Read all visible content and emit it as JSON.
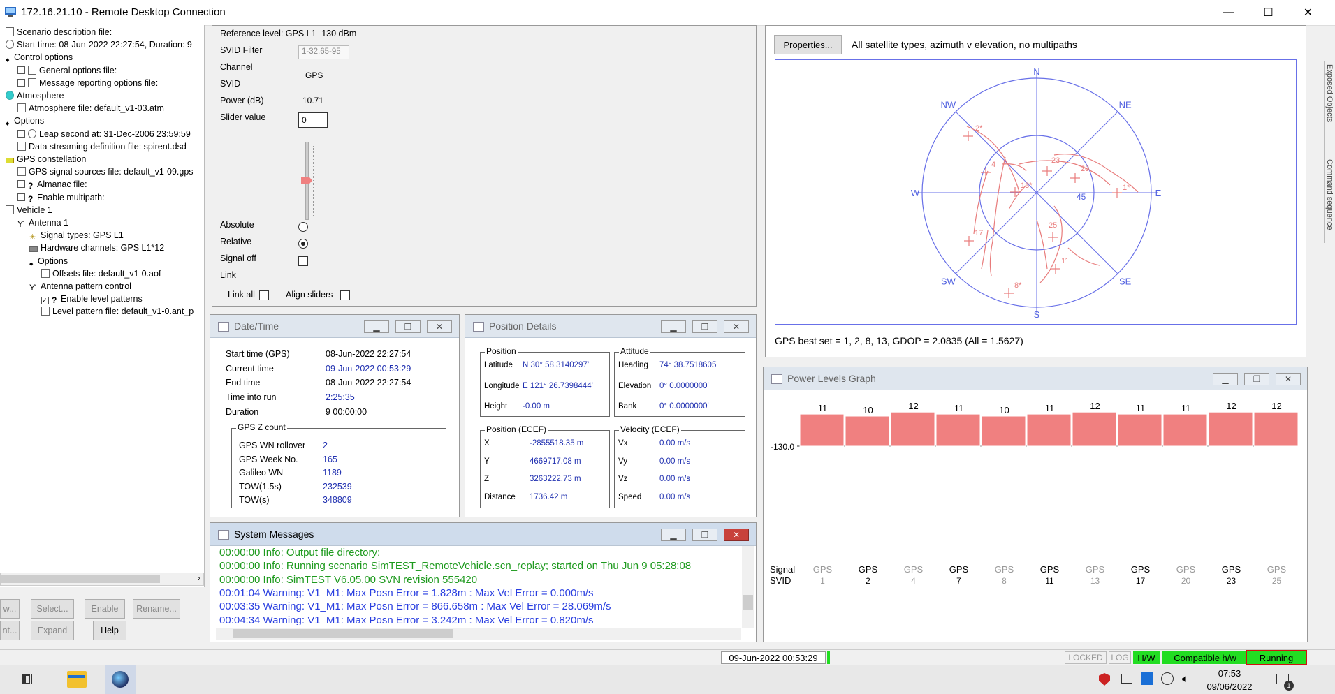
{
  "window": {
    "title": "172.16.21.10 - Remote Desktop Connection"
  },
  "tree": {
    "items": [
      "Scenario description file:",
      "Start time: 08-Jun-2022 22:27:54, Duration: 9",
      "Control  options",
      "General options file:",
      "Message reporting options file:",
      "Atmosphere",
      "Atmosphere file: default_v1-03.atm",
      "Options",
      "Leap second at: 31-Dec-2006 23:59:59",
      "Data streaming definition file: spirent.dsd",
      "GPS constellation",
      "GPS signal sources file: default_v1-09.gps",
      "Almanac file:",
      "Enable multipath:",
      "Vehicle 1",
      "Antenna  1",
      "Signal types: GPS L1",
      "Hardware channels: GPS L1*12",
      "Options",
      "Offsets file: default_v1-0.aof",
      "Antenna pattern control",
      "Enable level patterns",
      "Level pattern file: default_v1-0.ant_p"
    ],
    "buttons": [
      "w...",
      "Select...",
      "Enable",
      "Rename...",
      "nt...",
      "Expand",
      "Help"
    ]
  },
  "power_panel": {
    "reference_level": "Reference level: GPS L1 -130 dBm",
    "svid_filter_label": "SVID Filter",
    "svid_filter_value": "1-32,65-95",
    "channel_label": "Channel",
    "svid_label": "SVID",
    "svid_value": "GPS",
    "power_label": "Power (dB)",
    "power_value": "10.71",
    "slider_label": "Slider value",
    "slider_value": "0",
    "absolute_label": "Absolute",
    "relative_label": "Relative",
    "signal_off_label": "Signal off",
    "link_label": "Link",
    "link_all_label": "Link all",
    "align_sliders_label": "Align sliders"
  },
  "datetime": {
    "title": "Date/Time",
    "rows": [
      {
        "label": "Start time (GPS)",
        "value": "08-Jun-2022 22:27:54"
      },
      {
        "label": "Current time",
        "value": "09-Jun-2022 00:53:29"
      },
      {
        "label": "End time",
        "value": "08-Jun-2022 22:27:54"
      },
      {
        "label": "Time into run",
        "value": "2:25:35"
      },
      {
        "label": "Duration",
        "value": "9 00:00:00"
      }
    ],
    "zcount_title": "GPS Z count",
    "zcount": [
      {
        "label": "GPS WN rollover",
        "value": "2"
      },
      {
        "label": "GPS Week No.",
        "value": "165"
      },
      {
        "label": "Galileo WN",
        "value": "1189"
      },
      {
        "label": "TOW(1.5s)",
        "value": "232539"
      },
      {
        "label": "TOW(s)",
        "value": "348809"
      }
    ]
  },
  "position": {
    "title": "Position Details",
    "pos_title": "Position",
    "pos": [
      {
        "label": "Latitude",
        "value": "N 30° 58.3140297'"
      },
      {
        "label": "Longitude",
        "value": "E 121° 26.7398444'"
      },
      {
        "label": "Height",
        "value": "-0.00 m"
      }
    ],
    "att_title": "Attitude",
    "att": [
      {
        "label": "Heading",
        "value": "74° 38.7518605'"
      },
      {
        "label": "Elevation",
        "value": "0° 0.0000000'"
      },
      {
        "label": "Bank",
        "value": "0° 0.0000000'"
      }
    ],
    "ecef_title": "Position (ECEF)",
    "ecef": [
      {
        "label": "X",
        "value": "-2855518.35 m"
      },
      {
        "label": "Y",
        "value": "4669717.08 m"
      },
      {
        "label": "Z",
        "value": "3263222.73 m"
      },
      {
        "label": "Distance",
        "value": "1736.42 m"
      }
    ],
    "vel_title": "Velocity (ECEF)",
    "vel": [
      {
        "label": "Vx",
        "value": "0.00 m/s"
      },
      {
        "label": "Vy",
        "value": "0.00 m/s"
      },
      {
        "label": "Vz",
        "value": "0.00 m/s"
      },
      {
        "label": "Speed",
        "value": "0.00 m/s"
      }
    ]
  },
  "sysmsg": {
    "title": "System Messages",
    "lines": [
      {
        "text": "00:00:00 Info:     Output file directory:",
        "color": "#1e9a1e"
      },
      {
        "text": "00:00:00 Info: Running scenario SimTEST_RemoteVehicle.scn_replay; started on Thu Jun  9 05:28:08",
        "color": "#1e9a1e"
      },
      {
        "text": "00:00:00 Info: SimTEST V6.05.00 SVN revision 555420",
        "color": "#1e9a1e"
      },
      {
        "text": "00:01:04 Warning: V1_M1: Max Posn Error = 1.828m : Max Vel Error = 0.000m/s",
        "color": "#2a3fe0"
      },
      {
        "text": "00:03:35 Warning: V1_M1: Max Posn Error = 866.658m : Max Vel Error = 28.069m/s",
        "color": "#2a3fe0"
      },
      {
        "text": "00:04:34 Warning: V1_M1: Max Posn Error = 3.242m : Max Vel Error = 0.820m/s",
        "color": "#2a3fe0"
      }
    ]
  },
  "skyplot": {
    "properties_button": "Properties...",
    "description": "All satellite types, azimuth v elevation, no multipaths",
    "directions": [
      "N",
      "NE",
      "E",
      "SE",
      "S",
      "SW",
      "W",
      "NW"
    ],
    "ring_label": "45",
    "gdop_text": "GPS best set = 1, 2, 8, 13, GDOP = 2.0835 (All = 1.5627)",
    "sats": [
      "2*",
      "4",
      "13*",
      "23",
      "20",
      "1*",
      "17",
      "25",
      "11",
      "8*"
    ]
  },
  "power_graph": {
    "title": "Power Levels Graph",
    "y_label": "-130.0",
    "row_label_signal": "Signal",
    "row_label_svid": "SVID",
    "color": "#f08080",
    "bars": [
      {
        "signal": "GPS",
        "svid": "1",
        "level": 11,
        "active": false
      },
      {
        "signal": "GPS",
        "svid": "2",
        "level": 10,
        "active": true
      },
      {
        "signal": "GPS",
        "svid": "4",
        "level": 12,
        "active": false
      },
      {
        "signal": "GPS",
        "svid": "7",
        "level": 11,
        "active": true
      },
      {
        "signal": "GPS",
        "svid": "8",
        "level": 10,
        "active": false
      },
      {
        "signal": "GPS",
        "svid": "11",
        "level": 11,
        "active": true
      },
      {
        "signal": "GPS",
        "svid": "13",
        "level": 12,
        "active": false
      },
      {
        "signal": "GPS",
        "svid": "17",
        "level": 11,
        "active": true
      },
      {
        "signal": "GPS",
        "svid": "20",
        "level": 11,
        "active": false
      },
      {
        "signal": "GPS",
        "svid": "23",
        "level": 12,
        "active": true
      },
      {
        "signal": "GPS",
        "svid": "25",
        "level": 12,
        "active": false
      }
    ]
  },
  "status": {
    "datetime": "09-Jun-2022 00:53:29",
    "locked": "LOCKED",
    "log": "LOG",
    "hw": "H/W",
    "compatible": "Compatible h/w",
    "running": "Running",
    "green": "#22dd22"
  },
  "taskbar": {
    "time": "07:53",
    "date": "09/06/2022",
    "notif": "1"
  },
  "side_tabs": [
    "Exposed Objects",
    "Command sequence"
  ]
}
